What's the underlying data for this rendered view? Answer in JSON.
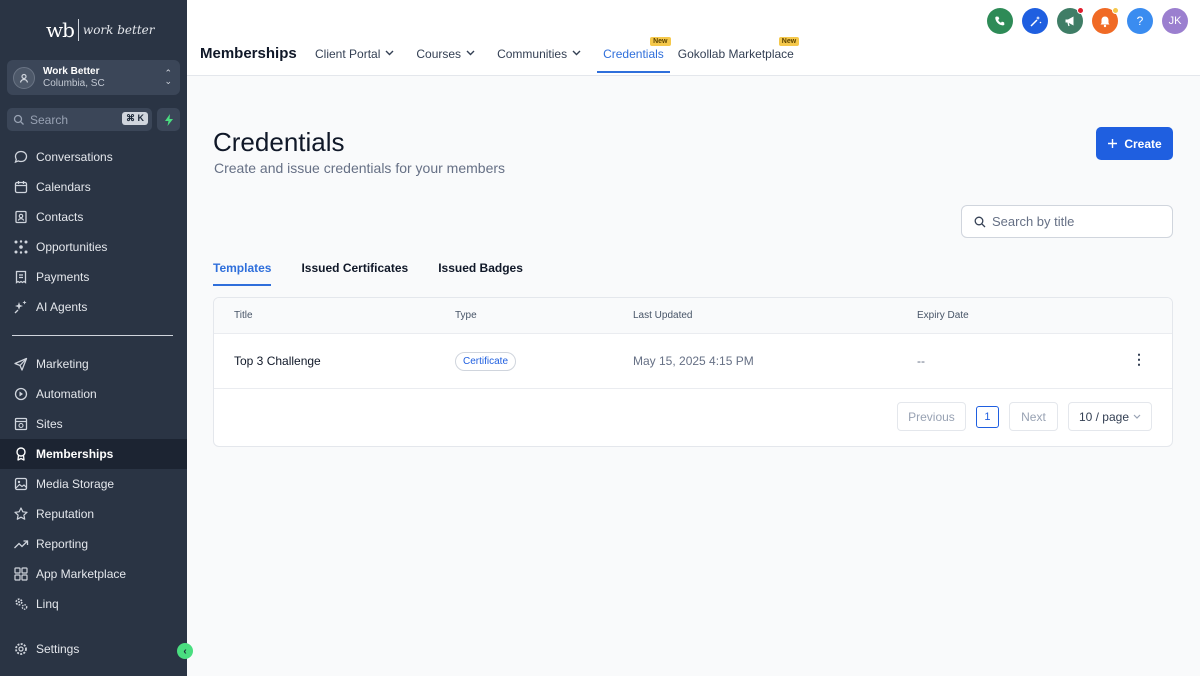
{
  "sidebar": {
    "logo_mark": "wb",
    "logo_word": "work better",
    "account": {
      "name": "Work Better",
      "location": "Columbia, SC"
    },
    "search": {
      "placeholder": "Search",
      "shortcut": "⌘ K"
    },
    "items_top": [
      {
        "label": "Conversations",
        "icon": "chat-icon"
      },
      {
        "label": "Calendars",
        "icon": "calendar-icon"
      },
      {
        "label": "Contacts",
        "icon": "contacts-icon"
      },
      {
        "label": "Opportunities",
        "icon": "opportunities-icon"
      },
      {
        "label": "Payments",
        "icon": "payments-icon"
      },
      {
        "label": "AI Agents",
        "icon": "sparkle-icon"
      }
    ],
    "items_bottom": [
      {
        "label": "Marketing",
        "icon": "send-icon"
      },
      {
        "label": "Automation",
        "icon": "automation-icon"
      },
      {
        "label": "Sites",
        "icon": "sites-icon"
      },
      {
        "label": "Memberships",
        "icon": "award-icon"
      },
      {
        "label": "Media Storage",
        "icon": "image-icon"
      },
      {
        "label": "Reputation",
        "icon": "star-icon"
      },
      {
        "label": "Reporting",
        "icon": "trend-icon"
      },
      {
        "label": "App Marketplace",
        "icon": "grid-icon"
      },
      {
        "label": "Linq",
        "icon": "gears-icon"
      }
    ],
    "settings_label": "Settings"
  },
  "topbar": {
    "module": "Memberships",
    "tabs": [
      {
        "label": "Client Portal",
        "caret": "⌄"
      },
      {
        "label": "Courses",
        "caret": "⌄"
      },
      {
        "label": "Communities",
        "caret": "⌄"
      },
      {
        "label": "Credentials",
        "new": "New"
      },
      {
        "label": "Gokollab Marketplace",
        "new": "New"
      }
    ],
    "avatar_initials": "JK",
    "help": "?",
    "colors": {
      "phone": "#2e8b57",
      "magic": "#1f5fe0",
      "megaphone": "#3f7d66",
      "bell": "#f06a25",
      "help": "#3a8cf0",
      "avatar": "#9b7fcf"
    }
  },
  "main": {
    "title": "Credentials",
    "subtitle": "Create and issue credentials for your members",
    "create_label": "Create",
    "search_placeholder": "Search by title",
    "tabs": [
      "Templates",
      "Issued Certificates",
      "Issued Badges"
    ],
    "columns": [
      "Title",
      "Type",
      "Last Updated",
      "Expiry Date"
    ],
    "rows": [
      {
        "title": "Top 3 Challenge",
        "type": "Certificate",
        "updated": "May 15, 2025 4:15 PM",
        "expiry": "--"
      }
    ],
    "pagination": {
      "prev": "Previous",
      "page": "1",
      "next": "Next",
      "size": "10 / page"
    }
  }
}
